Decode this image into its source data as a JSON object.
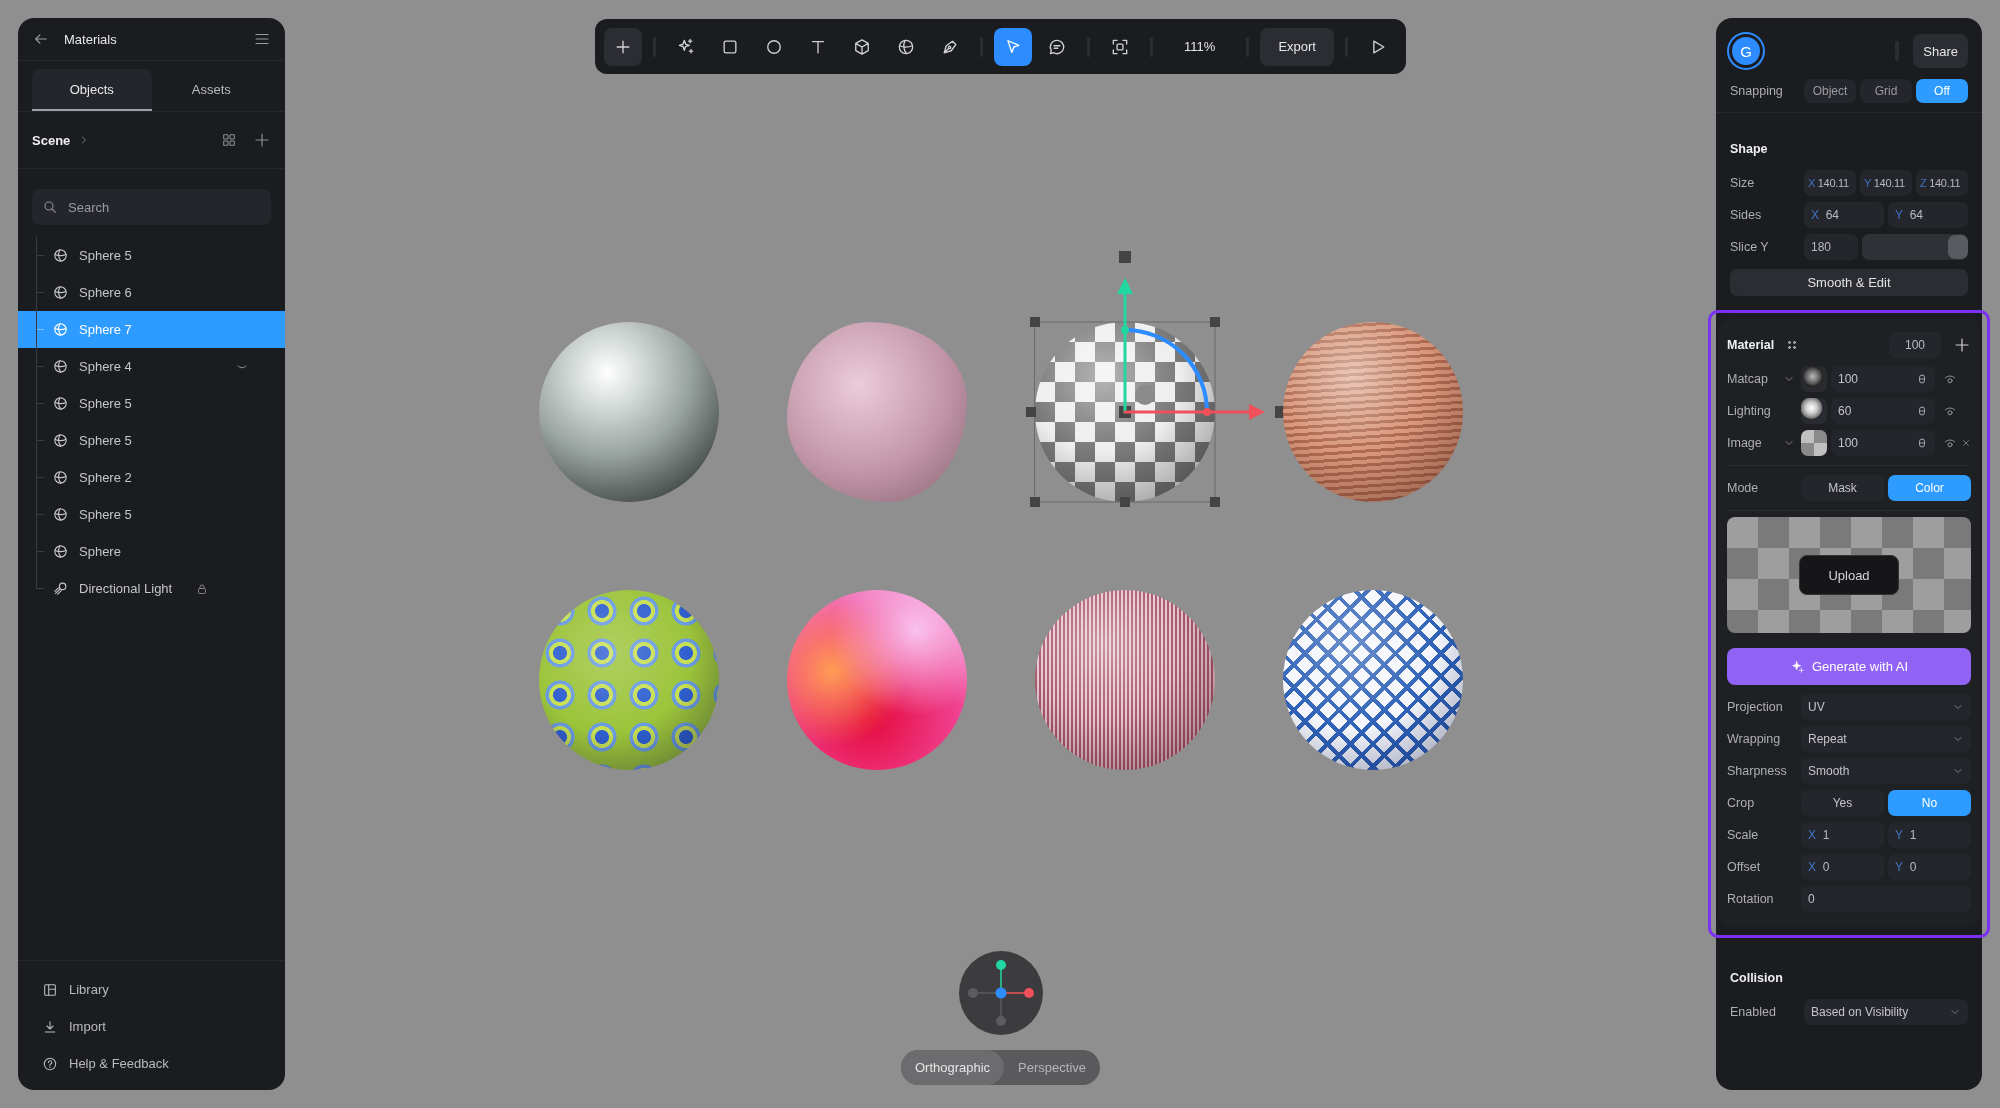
{
  "left_panel": {
    "title": "Materials",
    "tabs": [
      {
        "label": "Objects",
        "selected": true
      },
      {
        "label": "Assets",
        "selected": false
      }
    ],
    "scene_label": "Scene",
    "search": {
      "placeholder": "Search"
    },
    "items": [
      {
        "label": "Sphere 5",
        "kind": "sphere",
        "selected": false,
        "hidden": false,
        "locked": false
      },
      {
        "label": "Sphere 6",
        "kind": "sphere",
        "selected": false,
        "hidden": false,
        "locked": false
      },
      {
        "label": "Sphere 7",
        "kind": "sphere",
        "selected": true,
        "hidden": false,
        "locked": false
      },
      {
        "label": "Sphere 4",
        "kind": "sphere",
        "selected": false,
        "hidden": true,
        "locked": false
      },
      {
        "label": "Sphere 5",
        "kind": "sphere",
        "selected": false,
        "hidden": false,
        "locked": false
      },
      {
        "label": "Sphere 5",
        "kind": "sphere",
        "selected": false,
        "hidden": false,
        "locked": false
      },
      {
        "label": "Sphere 2",
        "kind": "sphere",
        "selected": false,
        "hidden": false,
        "locked": false
      },
      {
        "label": "Sphere 5",
        "kind": "sphere",
        "selected": false,
        "hidden": false,
        "locked": false
      },
      {
        "label": "Sphere",
        "kind": "sphere",
        "selected": false,
        "hidden": false,
        "locked": false
      },
      {
        "label": "Directional Light",
        "kind": "light",
        "selected": false,
        "hidden": false,
        "locked": true
      }
    ],
    "footer": [
      {
        "label": "Library",
        "kind": "library"
      },
      {
        "label": "Import",
        "kind": "import"
      },
      {
        "label": "Help & Feedback",
        "kind": "help"
      }
    ]
  },
  "toolbar": {
    "tool_groups": [
      [
        {
          "kind": "add",
          "selected": false
        }
      ],
      [
        {
          "kind": "sparkle",
          "selected": false
        },
        {
          "kind": "rectangle",
          "selected": false
        },
        {
          "kind": "ellipse",
          "selected": false
        },
        {
          "kind": "text",
          "selected": false
        },
        {
          "kind": "cube",
          "selected": false
        },
        {
          "kind": "sphere",
          "selected": false
        },
        {
          "kind": "pen",
          "selected": false
        }
      ],
      [
        {
          "kind": "pointer",
          "selected": true
        },
        {
          "kind": "comment",
          "selected": false
        }
      ],
      [
        {
          "kind": "frame",
          "selected": false
        }
      ]
    ],
    "zoom": "111%",
    "export": "Export"
  },
  "canvas": {
    "objects": [
      {
        "kind": "metal",
        "selected": false
      },
      {
        "kind": "lumpy",
        "selected": false
      },
      {
        "kind": "checker",
        "selected": true
      },
      {
        "kind": "wood",
        "selected": false
      },
      {
        "kind": "spotted",
        "selected": false
      },
      {
        "kind": "gradient",
        "selected": false
      },
      {
        "kind": "striped",
        "selected": false
      },
      {
        "kind": "lattice",
        "selected": false
      }
    ],
    "view_modes": [
      {
        "label": "Orthographic",
        "selected": true
      },
      {
        "label": "Perspective",
        "selected": false
      }
    ]
  },
  "right_panel": {
    "avatar": "G",
    "share": "Share",
    "snapping": {
      "label": "Snapping",
      "options": [
        {
          "label": "Object",
          "selected": false
        },
        {
          "label": "Grid",
          "selected": false
        },
        {
          "label": "Off",
          "selected": true
        }
      ]
    },
    "shape": {
      "title": "Shape",
      "size": {
        "label": "Size",
        "fields": [
          {
            "axis": "X",
            "value": "140.11"
          },
          {
            "axis": "Y",
            "value": "140.11"
          },
          {
            "axis": "Z",
            "value": "140.11"
          }
        ]
      },
      "sides": {
        "label": "Sides",
        "fields": [
          {
            "axis": "X",
            "value": "64"
          },
          {
            "axis": "Y",
            "value": "64"
          }
        ]
      },
      "slice": {
        "label": "Slice Y",
        "value": "180",
        "level": 1
      },
      "action": "Smooth & Edit"
    },
    "material": {
      "title": "Material",
      "opacity": "100",
      "layers": [
        {
          "label": "Matcap",
          "kind": "matcap",
          "value": "100",
          "dropdown": true,
          "removable": false
        },
        {
          "label": "Lighting",
          "kind": "lighting",
          "value": "60",
          "dropdown": false,
          "removable": false
        },
        {
          "label": "Image",
          "kind": "image",
          "value": "100",
          "dropdown": true,
          "removable": true
        }
      ],
      "mode": {
        "label": "Mode",
        "options": [
          {
            "label": "Mask",
            "selected": false
          },
          {
            "label": "Color",
            "selected": true
          }
        ]
      },
      "upload": "Upload",
      "generate": "Generate with AI",
      "selects": [
        {
          "label": "Projection",
          "value": "UV"
        },
        {
          "label": "Wrapping",
          "value": "Repeat"
        },
        {
          "label": "Sharpness",
          "value": "Smooth"
        }
      ],
      "crop": {
        "label": "Crop",
        "options": [
          {
            "label": "Yes",
            "selected": false
          },
          {
            "label": "No",
            "selected": true
          }
        ]
      },
      "scale": {
        "label": "Scale",
        "fields": [
          {
            "axis": "X",
            "value": "1"
          },
          {
            "axis": "Y",
            "value": "1"
          }
        ]
      },
      "offset": {
        "label": "Offset",
        "fields": [
          {
            "axis": "X",
            "value": "0"
          },
          {
            "axis": "Y",
            "value": "0"
          }
        ]
      },
      "rotation": {
        "label": "Rotation",
        "value": "0"
      }
    },
    "collision": {
      "title": "Collision",
      "enabled": {
        "label": "Enabled",
        "value": "Based on Visibility"
      }
    }
  }
}
